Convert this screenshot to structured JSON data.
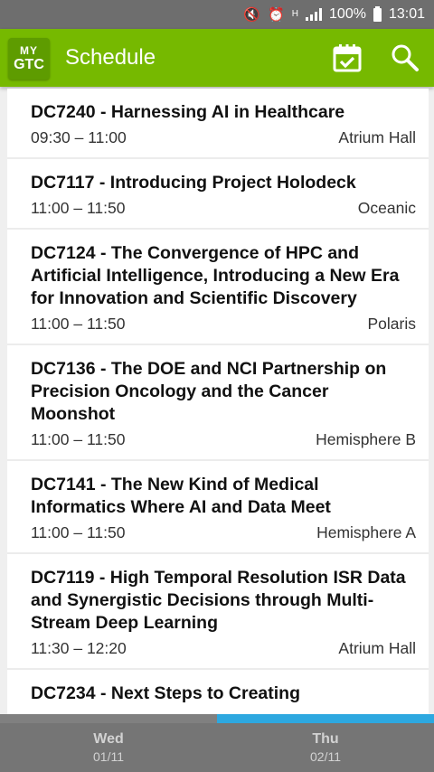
{
  "status_bar": {
    "battery": "100%",
    "time": "13:01",
    "network_label": "H"
  },
  "app": {
    "logo_line1": "MY",
    "logo_line2": "GTC",
    "title": "Schedule"
  },
  "sessions": [
    {
      "title": "DC7240 - Harnessing AI in Healthcare",
      "time": "09:30 – 11:00",
      "room": "Atrium Hall"
    },
    {
      "title": "DC7117 - Introducing Project Holodeck",
      "time": "11:00 – 11:50",
      "room": "Oceanic"
    },
    {
      "title": "DC7124 - The Convergence of HPC and Artificial Intelligence, Introducing a New Era for Innovation and Scientific Discovery",
      "time": "11:00 – 11:50",
      "room": "Polaris"
    },
    {
      "title": "DC7136 - The DOE and NCI Partnership on Precision Oncology and the Cancer Moonshot",
      "time": "11:00 – 11:50",
      "room": "Hemisphere B"
    },
    {
      "title": "DC7141 - The New Kind of Medical Informatics Where AI and Data Meet",
      "time": "11:00 – 11:50",
      "room": "Hemisphere A"
    },
    {
      "title": "DC7119 - High Temporal Resolution ISR Data and Synergistic Decisions through Multi-Stream Deep Learning",
      "time": "11:30 – 12:20",
      "room": "Atrium Hall"
    },
    {
      "title": "DC7234 - Next Steps to Creating",
      "time": "",
      "room": ""
    }
  ],
  "tabs": [
    {
      "day": "Wed",
      "date": "01/11"
    },
    {
      "day": "Thu",
      "date": "02/11"
    }
  ],
  "colors": {
    "app_bar": "#76b900",
    "tab_indicator": "#2da8e0"
  }
}
